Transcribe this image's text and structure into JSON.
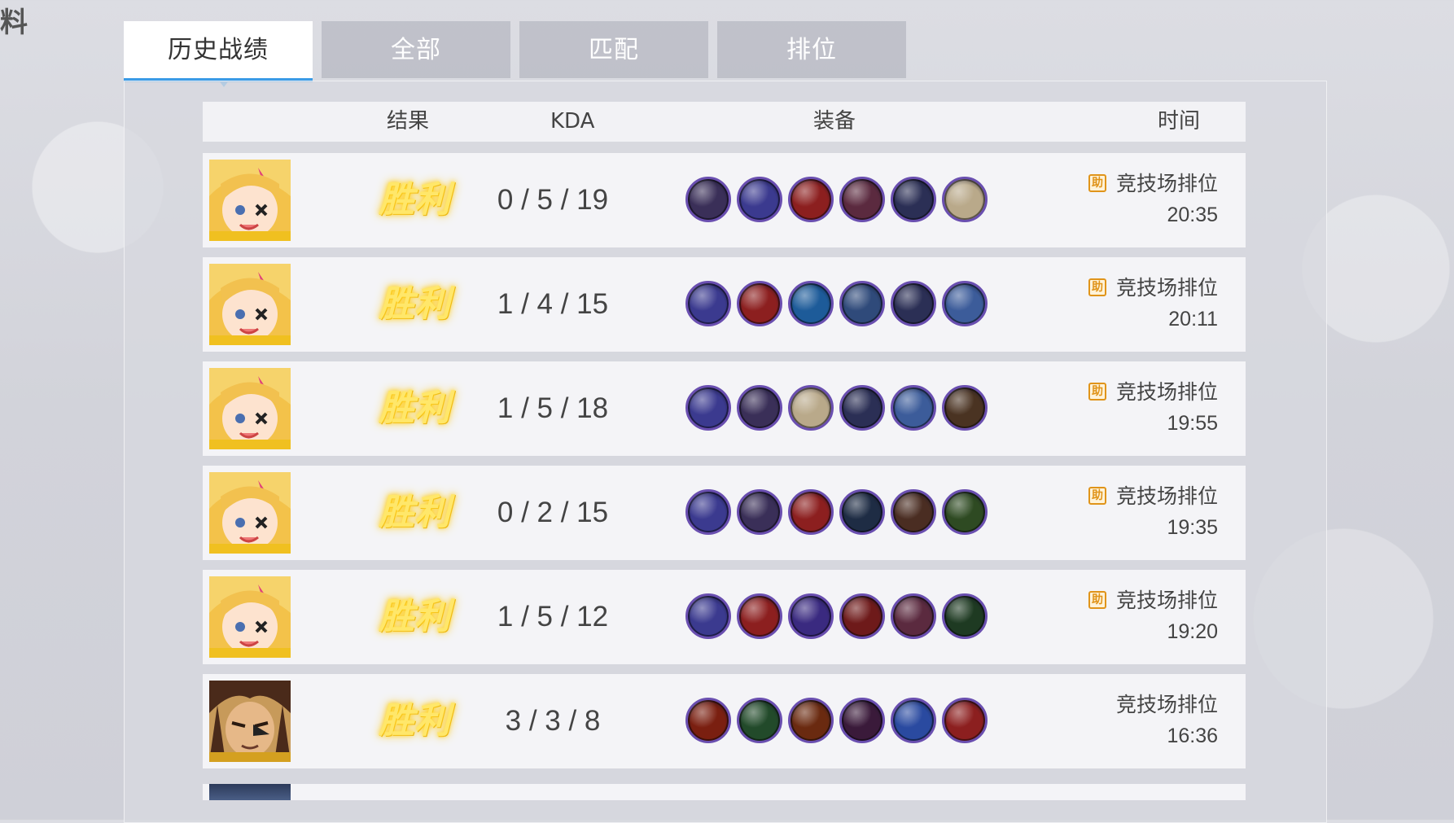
{
  "edge_glyph": "料",
  "tabs": [
    {
      "label": "历史战绩",
      "active": true
    },
    {
      "label": "全部",
      "active": false
    },
    {
      "label": "匹配",
      "active": false
    },
    {
      "label": "排位",
      "active": false
    }
  ],
  "columns": {
    "result": "结果",
    "kda": "KDA",
    "equipment": "装备",
    "time": "时间"
  },
  "rows": [
    {
      "hero": "blonde-hero-avatar",
      "result": "胜利",
      "kda": "0 / 5 / 19",
      "assist_icon": "助",
      "mode": "竞技场排位",
      "time": "20:35",
      "items": [
        {
          "icon": "sword-staff-item",
          "color": "#3a2f58"
        },
        {
          "icon": "purple-blade-item",
          "color": "#3b3a8f"
        },
        {
          "icon": "red-gauntlet-item",
          "color": "#8c1f1f"
        },
        {
          "icon": "bone-charm-item",
          "color": "#5b2a3f"
        },
        {
          "icon": "leather-belt-item",
          "color": "#2b2f55"
        },
        {
          "icon": "white-robe-item",
          "color": "#b9a98a"
        }
      ]
    },
    {
      "hero": "blonde-hero-avatar",
      "result": "胜利",
      "kda": "1 / 4 / 15",
      "assist_icon": "助",
      "mode": "竞技场排位",
      "time": "20:11",
      "items": [
        {
          "icon": "purple-blade-item",
          "color": "#3b3a8f"
        },
        {
          "icon": "red-gauntlet-item",
          "color": "#8c1f1f"
        },
        {
          "icon": "ice-boot-item",
          "color": "#1d5b99"
        },
        {
          "icon": "golden-hammer-item",
          "color": "#2f4a7a"
        },
        {
          "icon": "leather-belt-item",
          "color": "#2b2f55"
        },
        {
          "icon": "steel-ring-item",
          "color": "#3c5c9a"
        }
      ]
    },
    {
      "hero": "blonde-hero-avatar",
      "result": "胜利",
      "kda": "1 / 5 / 18",
      "assist_icon": "助",
      "mode": "竞技场排位",
      "time": "19:55",
      "items": [
        {
          "icon": "purple-blade-item",
          "color": "#3b3a8f"
        },
        {
          "icon": "sword-staff-item",
          "color": "#3a2f58"
        },
        {
          "icon": "white-robe-item",
          "color": "#b9a98a"
        },
        {
          "icon": "leather-belt-item",
          "color": "#2b2f55"
        },
        {
          "icon": "steel-ring-item",
          "color": "#3c5c9a"
        },
        {
          "icon": "horned-helmet-item",
          "color": "#4a3322"
        }
      ]
    },
    {
      "hero": "blonde-hero-avatar",
      "result": "胜利",
      "kda": "0 / 2 / 15",
      "assist_icon": "助",
      "mode": "竞技场排位",
      "time": "19:35",
      "items": [
        {
          "icon": "purple-blade-item",
          "color": "#3b3a8f"
        },
        {
          "icon": "sword-staff-item",
          "color": "#3a2f58"
        },
        {
          "icon": "red-gauntlet-item",
          "color": "#8c1f1f"
        },
        {
          "icon": "blue-boot-item",
          "color": "#1e2c44"
        },
        {
          "icon": "brown-claw-item",
          "color": "#4a2d22"
        },
        {
          "icon": "green-orb-item",
          "color": "#2e4a22"
        }
      ]
    },
    {
      "hero": "blonde-hero-avatar",
      "result": "胜利",
      "kda": "1 / 5 / 12",
      "assist_icon": "助",
      "mode": "竞技场排位",
      "time": "19:20",
      "items": [
        {
          "icon": "purple-blade-item",
          "color": "#3b3a8f"
        },
        {
          "icon": "red-gauntlet-item",
          "color": "#8c1f1f"
        },
        {
          "icon": "purple-scroll-item",
          "color": "#3a2a80"
        },
        {
          "icon": "fire-wing-item",
          "color": "#6e1a1a"
        },
        {
          "icon": "bone-charm-item",
          "color": "#5b2a3f"
        },
        {
          "icon": "green-spear-item",
          "color": "#1e3a22"
        }
      ]
    },
    {
      "hero": "bearded-hero-avatar",
      "result": "胜利",
      "kda": "3 / 3 / 8",
      "assist_icon": "",
      "mode": "竞技场排位",
      "time": "16:36",
      "items": [
        {
          "icon": "flame-armor-item",
          "color": "#7a1f10"
        },
        {
          "icon": "green-beast-item",
          "color": "#224a2a"
        },
        {
          "icon": "fire-boot-item",
          "color": "#6a2a10"
        },
        {
          "icon": "dark-mask-item",
          "color": "#3a1a3a"
        },
        {
          "icon": "blue-crystal-item",
          "color": "#2a4aa0"
        },
        {
          "icon": "red-gauntlet-item",
          "color": "#8c1f1f"
        }
      ]
    }
  ]
}
